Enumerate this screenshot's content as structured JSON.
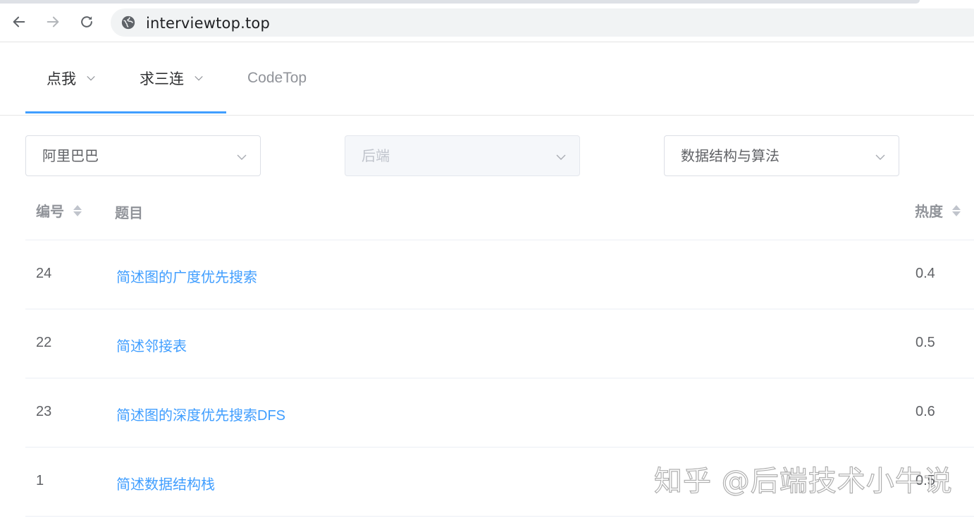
{
  "browser": {
    "url": "interviewtop.top",
    "icons": [
      "back-arrow-icon",
      "forward-arrow-icon",
      "reload-icon",
      "site-info-icon"
    ]
  },
  "menu": {
    "items": [
      {
        "label": "点我",
        "has_dropdown": true
      },
      {
        "label": "求三连",
        "has_dropdown": true
      },
      {
        "label": "CodeTop",
        "has_dropdown": false
      }
    ],
    "accent_color": "#409eff"
  },
  "filters": {
    "company": {
      "value": "阿里巴巴"
    },
    "position": {
      "value": "后端",
      "disabled": true
    },
    "category": {
      "value": "数据结构与算法"
    }
  },
  "table": {
    "headers": {
      "id": "编号",
      "title": "题目",
      "heat": "热度"
    },
    "rows": [
      {
        "id": "24",
        "title": "简述图的广度优先搜索",
        "heat": "0.4"
      },
      {
        "id": "22",
        "title": "简述邻接表",
        "heat": "0.5"
      },
      {
        "id": "23",
        "title": "简述图的深度优先搜索DFS",
        "heat": "0.6"
      },
      {
        "id": "1",
        "title": "简述数据结构栈",
        "heat": "0.5"
      }
    ],
    "link_color": "#409eff"
  },
  "watermark": {
    "text": "知乎 @后端技术小牛说"
  }
}
